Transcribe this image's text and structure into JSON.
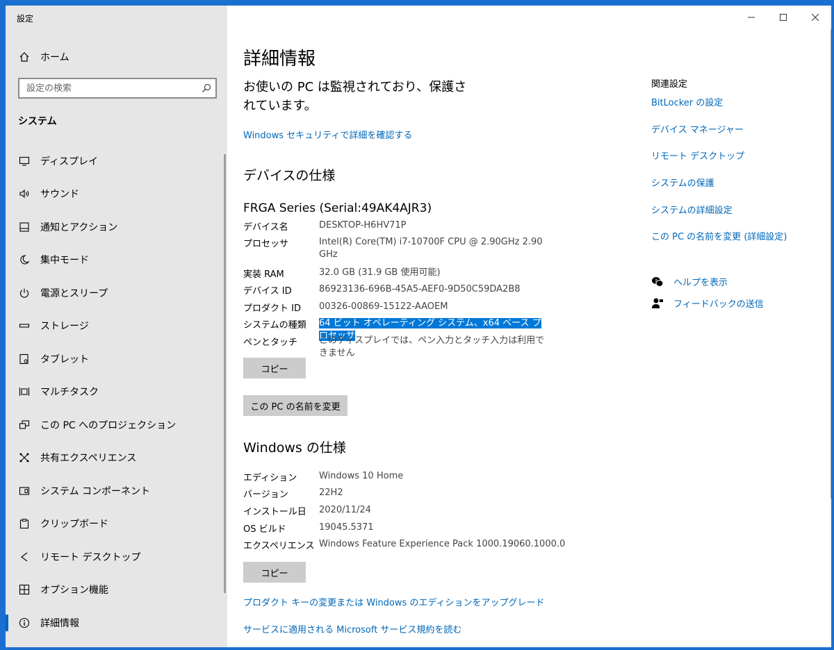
{
  "window": {
    "app_title": "設定"
  },
  "sidebar": {
    "home": "ホーム",
    "search_placeholder": "設定の検索",
    "section": "システム",
    "items": [
      {
        "label": "ディスプレイ",
        "icon": "monitor-icon"
      },
      {
        "label": "サウンド",
        "icon": "speaker-icon"
      },
      {
        "label": "通知とアクション",
        "icon": "notification-icon"
      },
      {
        "label": "集中モード",
        "icon": "moon-icon"
      },
      {
        "label": "電源とスリープ",
        "icon": "power-icon"
      },
      {
        "label": "ストレージ",
        "icon": "storage-icon"
      },
      {
        "label": "タブレット",
        "icon": "tablet-icon"
      },
      {
        "label": "マルチタスク",
        "icon": "multitask-icon"
      },
      {
        "label": "この PC へのプロジェクション",
        "icon": "projection-icon"
      },
      {
        "label": "共有エクスペリエンス",
        "icon": "share-icon"
      },
      {
        "label": "システム コンポーネント",
        "icon": "component-icon"
      },
      {
        "label": "クリップボード",
        "icon": "clipboard-icon"
      },
      {
        "label": "リモート デスクトップ",
        "icon": "remote-icon"
      },
      {
        "label": "オプション機能",
        "icon": "options-icon"
      },
      {
        "label": "詳細情報",
        "icon": "info-icon"
      }
    ]
  },
  "main": {
    "title": "詳細情報",
    "protection": "お使いの PC は監視されており、保護されています。",
    "security_link": "Windows セキュリティで詳細を確認する",
    "device_spec_heading": "デバイスの仕様",
    "device_name": "FRGA Series (Serial:49AK4AJR3)",
    "device_specs": [
      {
        "label": "デバイス名",
        "value": "DESKTOP-H6HV71P"
      },
      {
        "label": "プロセッサ",
        "value": "Intel(R) Core(TM) i7-10700F CPU @ 2.90GHz   2.90 GHz"
      },
      {
        "label": "実装 RAM",
        "value": "32.0 GB (31.9 GB 使用可能)"
      },
      {
        "label": "デバイス ID",
        "value": "86923136-696B-45A5-AEF0-9D50C59DA2B8"
      },
      {
        "label": "プロダクト ID",
        "value": "00326-00869-15122-AAOEM"
      },
      {
        "label": "システムの種類",
        "value": "64 ビット オペレーティング システム、x64 ベース プロセッサ"
      },
      {
        "label": "ペンとタッチ",
        "value": "このディスプレイでは、ペン入力とタッチ入力は利用できません"
      }
    ],
    "copy_label": "コピー",
    "rename_label": "この PC の名前を変更",
    "windows_spec_heading": "Windows の仕様",
    "windows_specs": [
      {
        "label": "エディション",
        "value": "Windows 10 Home"
      },
      {
        "label": "バージョン",
        "value": "22H2"
      },
      {
        "label": "インストール日",
        "value": "2020/11/24"
      },
      {
        "label": "OS ビルド",
        "value": "19045.5371"
      },
      {
        "label": "エクスペリエンス",
        "value": "Windows Feature Experience Pack 1000.19060.1000.0"
      }
    ],
    "copy2_label": "コピー",
    "product_key_link": "プロダクト キーの変更または Windows のエディションをアップグレード",
    "terms_link": "サービスに適用される Microsoft サービス規約を読む"
  },
  "related": {
    "heading": "関連設定",
    "links": [
      "BitLocker の設定",
      "デバイス マネージャー",
      "リモート デスクトップ",
      "システムの保護",
      "システムの詳細設定",
      "この PC の名前を変更 (詳細設定)"
    ],
    "help": "ヘルプを表示",
    "feedback": "フィードバックの送信"
  }
}
